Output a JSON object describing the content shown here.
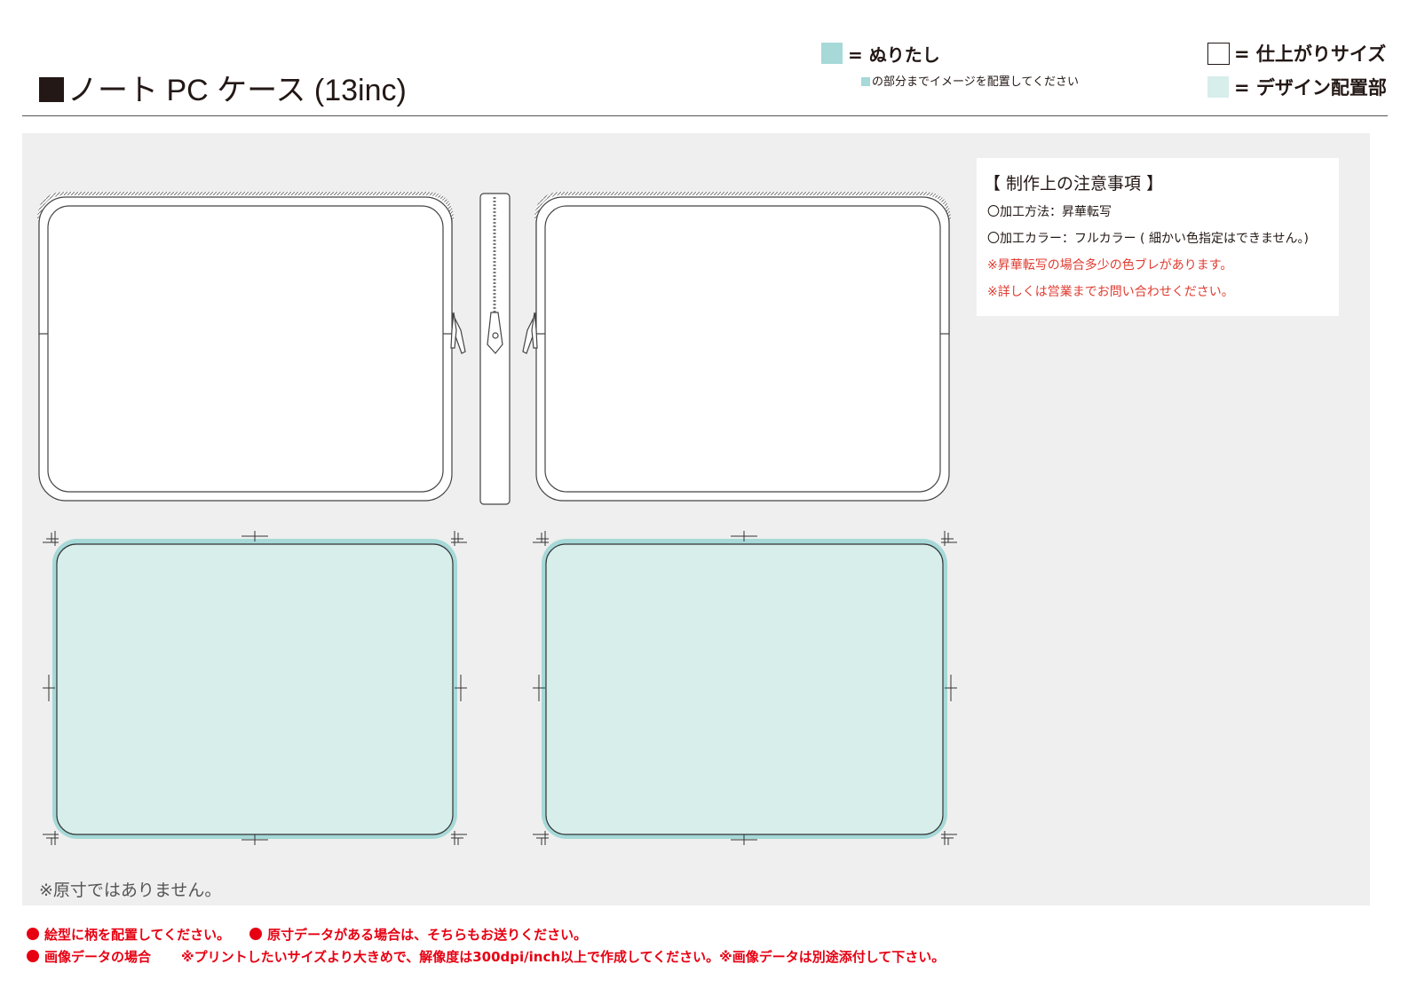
{
  "header": {
    "title": "ノート PC ケース (13inc)"
  },
  "legend": {
    "bleed_label": "= ぬりたし",
    "bleed_note": "の部分までイメージを配置してください",
    "finish_label": "= 仕上がりサイズ",
    "design_label": "= デザイン配置部",
    "bleed_color": "#a6d9d8",
    "design_color": "#d7eeeb"
  },
  "notes": {
    "heading": "【 制作上の注意事項 】",
    "method": "〇加工方法：昇華転写",
    "color": "〇加工カラー：フルカラー ( 細かい色指定はできません。)",
    "warn1": "※昇華転写の場合多少の色ブレがあります。",
    "warn2": "※詳しくは営業までお問い合わせください。"
  },
  "panel": {
    "not_actual_size": "※原寸ではありません。"
  },
  "footer": {
    "item1": "絵型に柄を配置してください。",
    "item2": "原寸データがある場合は、そちらもお送りください。",
    "item3_label": "画像データの場合",
    "item3_text": "※プリントしたいサイズより大きめで、解像度は300dpi/inch以上で作成してください。※画像データは別途添付して下さい。"
  }
}
